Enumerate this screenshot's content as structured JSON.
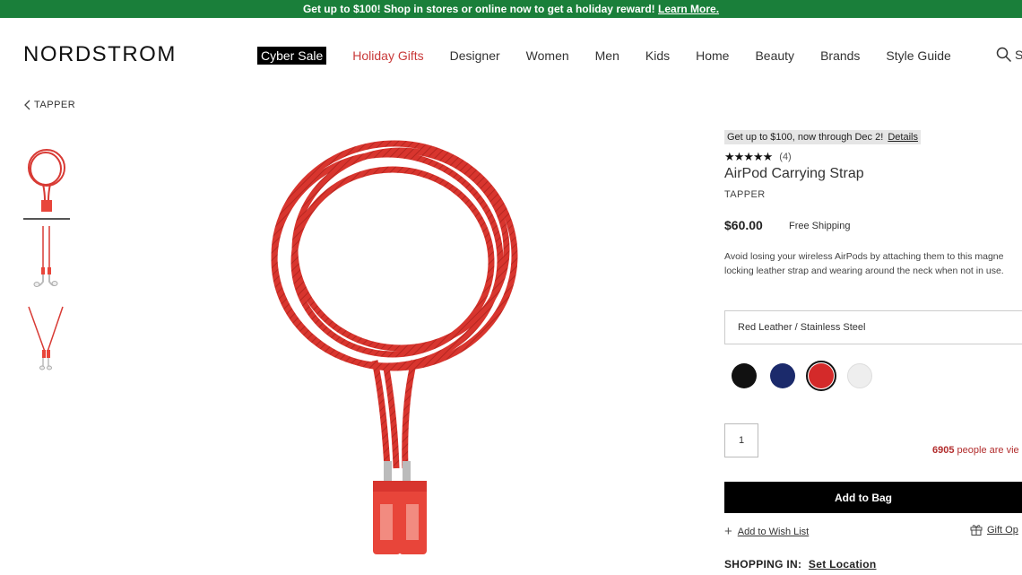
{
  "promo_banner": {
    "text": "Get up to $100! Shop in stores or online now to get a holiday reward!",
    "link": "Learn More."
  },
  "header": {
    "logo": "NORDSTROM",
    "nav": [
      "Cyber Sale",
      "Holiday Gifts",
      "Designer",
      "Women",
      "Men",
      "Kids",
      "Home",
      "Beauty",
      "Brands",
      "Style Guide"
    ],
    "search_label": "S"
  },
  "breadcrumb": {
    "back_label": "TAPPER"
  },
  "product": {
    "promo_text": "Get up to $100, now through Dec 2!",
    "promo_link": "Details",
    "stars": "★★★★★",
    "rating": 4.5,
    "review_count": "(4)",
    "title": "AirPod Carrying Strap",
    "brand": "TAPPER",
    "price": "$60.00",
    "shipping": "Free Shipping",
    "description_line1": "Avoid losing your wireless AirPods by attaching them to this magne",
    "description_line2": "locking leather strap and wearing around the neck when not in use.",
    "selected_option": "Red Leather / Stainless Steel",
    "swatches": [
      {
        "name": "black",
        "color": "#111111"
      },
      {
        "name": "navy",
        "color": "#1b2a6b"
      },
      {
        "name": "red",
        "color": "#d42a2a"
      },
      {
        "name": "white",
        "color": "#eeeeee"
      }
    ],
    "quantity": "1",
    "viewing_count": "6905",
    "viewing_text": "people are vie",
    "add_to_bag": "Add to Bag",
    "wish_list": "Add to Wish List",
    "gift_options": "Gift Op",
    "shopping_in_label": "SHOPPING IN:",
    "set_location": "Set Location"
  },
  "colors": {
    "promo_green": "#1a7f3a",
    "strap_red": "#d83a34",
    "sale_red": "#c93a3a"
  }
}
